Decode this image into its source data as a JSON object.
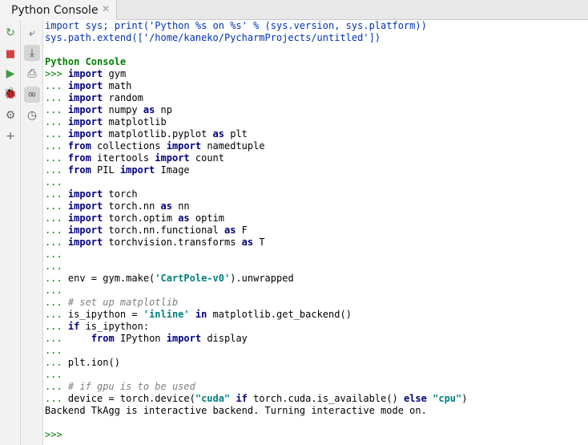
{
  "tab": {
    "title": "Python Console",
    "close_glyph": "✕"
  },
  "toolbar_left": [
    {
      "name": "rerun-icon",
      "glyph": "↻",
      "color": "#3c9c3c"
    },
    {
      "name": "stop-icon",
      "glyph": "■",
      "color": "#d64040"
    },
    {
      "name": "execute-icon",
      "glyph": "▶",
      "color": "#3c9c3c"
    },
    {
      "name": "debug-icon",
      "glyph": "🐞",
      "color": "#4a9c4a"
    },
    {
      "name": "settings-icon",
      "glyph": "⚙",
      "color": "#666666"
    },
    {
      "name": "add-icon",
      "glyph": "+",
      "color": "#666666"
    }
  ],
  "toolbar_right": [
    {
      "name": "soft-wrap-icon",
      "glyph": "⤶",
      "toggled": false
    },
    {
      "name": "scroll-to-end-icon",
      "glyph": "⤓",
      "toggled": true
    },
    {
      "name": "print-icon",
      "glyph": "⎙",
      "toggled": false
    },
    {
      "name": "show-variables-icon",
      "glyph": "∞",
      "toggled": true
    },
    {
      "name": "history-icon",
      "glyph": "◷",
      "toggled": false
    }
  ],
  "console_lines": [
    [
      [
        "blue",
        "import sys; print('Python %s on %s' % (sys.version, sys.platform))"
      ]
    ],
    [
      [
        "blue",
        "sys.path.extend(['/home/kaneko/PycharmProjects/untitled'])"
      ]
    ],
    [],
    [
      [
        "hdr",
        "Python Console"
      ]
    ],
    [
      [
        "pr",
        ">>> "
      ],
      [
        "kw",
        "import"
      ],
      [
        "",
        " gym"
      ]
    ],
    [
      [
        "pr",
        "... "
      ],
      [
        "kw",
        "import"
      ],
      [
        "",
        " math"
      ]
    ],
    [
      [
        "pr",
        "... "
      ],
      [
        "kw",
        "import"
      ],
      [
        "",
        " random"
      ]
    ],
    [
      [
        "pr",
        "... "
      ],
      [
        "kw",
        "import"
      ],
      [
        "",
        " numpy "
      ],
      [
        "kw",
        "as"
      ],
      [
        "",
        " np"
      ]
    ],
    [
      [
        "pr",
        "... "
      ],
      [
        "kw",
        "import"
      ],
      [
        "",
        " matplotlib"
      ]
    ],
    [
      [
        "pr",
        "... "
      ],
      [
        "kw",
        "import"
      ],
      [
        "",
        " matplotlib.pyplot "
      ],
      [
        "kw",
        "as"
      ],
      [
        "",
        " plt"
      ]
    ],
    [
      [
        "pr",
        "... "
      ],
      [
        "kw",
        "from"
      ],
      [
        "",
        " collections "
      ],
      [
        "kw",
        "import"
      ],
      [
        "",
        " namedtuple"
      ]
    ],
    [
      [
        "pr",
        "... "
      ],
      [
        "kw",
        "from"
      ],
      [
        "",
        " itertools "
      ],
      [
        "kw",
        "import"
      ],
      [
        "",
        " count"
      ]
    ],
    [
      [
        "pr",
        "... "
      ],
      [
        "kw",
        "from"
      ],
      [
        "",
        " PIL "
      ],
      [
        "kw",
        "import"
      ],
      [
        "",
        " Image"
      ]
    ],
    [
      [
        "pr",
        "..."
      ]
    ],
    [
      [
        "pr",
        "... "
      ],
      [
        "kw",
        "import"
      ],
      [
        "",
        " torch"
      ]
    ],
    [
      [
        "pr",
        "... "
      ],
      [
        "kw",
        "import"
      ],
      [
        "",
        " torch.nn "
      ],
      [
        "kw",
        "as"
      ],
      [
        "",
        " nn"
      ]
    ],
    [
      [
        "pr",
        "... "
      ],
      [
        "kw",
        "import"
      ],
      [
        "",
        " torch.optim "
      ],
      [
        "kw",
        "as"
      ],
      [
        "",
        " optim"
      ]
    ],
    [
      [
        "pr",
        "... "
      ],
      [
        "kw",
        "import"
      ],
      [
        "",
        " torch.nn.functional "
      ],
      [
        "kw",
        "as"
      ],
      [
        "",
        " F"
      ]
    ],
    [
      [
        "pr",
        "... "
      ],
      [
        "kw",
        "import"
      ],
      [
        "",
        " torchvision.transforms "
      ],
      [
        "kw",
        "as"
      ],
      [
        "",
        " T"
      ]
    ],
    [
      [
        "pr",
        "..."
      ]
    ],
    [
      [
        "pr",
        "..."
      ]
    ],
    [
      [
        "pr",
        "... "
      ],
      [
        "",
        "env = gym.make("
      ],
      [
        "str",
        "'CartPole-v0'"
      ],
      [
        "",
        ").unwrapped"
      ]
    ],
    [
      [
        "pr",
        "..."
      ]
    ],
    [
      [
        "pr",
        "... "
      ],
      [
        "cm",
        "# set up matplotlib"
      ]
    ],
    [
      [
        "pr",
        "... "
      ],
      [
        "",
        "is_ipython = "
      ],
      [
        "str",
        "'inline'"
      ],
      [
        "",
        " "
      ],
      [
        "kw",
        "in"
      ],
      [
        "",
        " matplotlib.get_backend()"
      ]
    ],
    [
      [
        "pr",
        "... "
      ],
      [
        "kw",
        "if"
      ],
      [
        "",
        " is_ipython:"
      ]
    ],
    [
      [
        "pr",
        "... "
      ],
      [
        "",
        "    "
      ],
      [
        "kw",
        "from"
      ],
      [
        "",
        " IPython "
      ],
      [
        "kw",
        "import"
      ],
      [
        "",
        " display"
      ]
    ],
    [
      [
        "pr",
        "..."
      ]
    ],
    [
      [
        "pr",
        "... "
      ],
      [
        "",
        "plt.ion()"
      ]
    ],
    [
      [
        "pr",
        "..."
      ]
    ],
    [
      [
        "pr",
        "... "
      ],
      [
        "cm",
        "# if gpu is to be used"
      ]
    ],
    [
      [
        "pr",
        "... "
      ],
      [
        "",
        "device = torch.device("
      ],
      [
        "str",
        "\"cuda\""
      ],
      [
        "",
        " "
      ],
      [
        "kw",
        "if"
      ],
      [
        "",
        " torch.cuda.is_available() "
      ],
      [
        "kw",
        "else"
      ],
      [
        "",
        " "
      ],
      [
        "str",
        "\"cpu\""
      ],
      [
        "",
        ")"
      ]
    ],
    [
      [
        "",
        "Backend TkAgg is interactive backend. Turning interactive mode on."
      ]
    ],
    [],
    [
      [
        "pr",
        ">>> "
      ]
    ]
  ]
}
